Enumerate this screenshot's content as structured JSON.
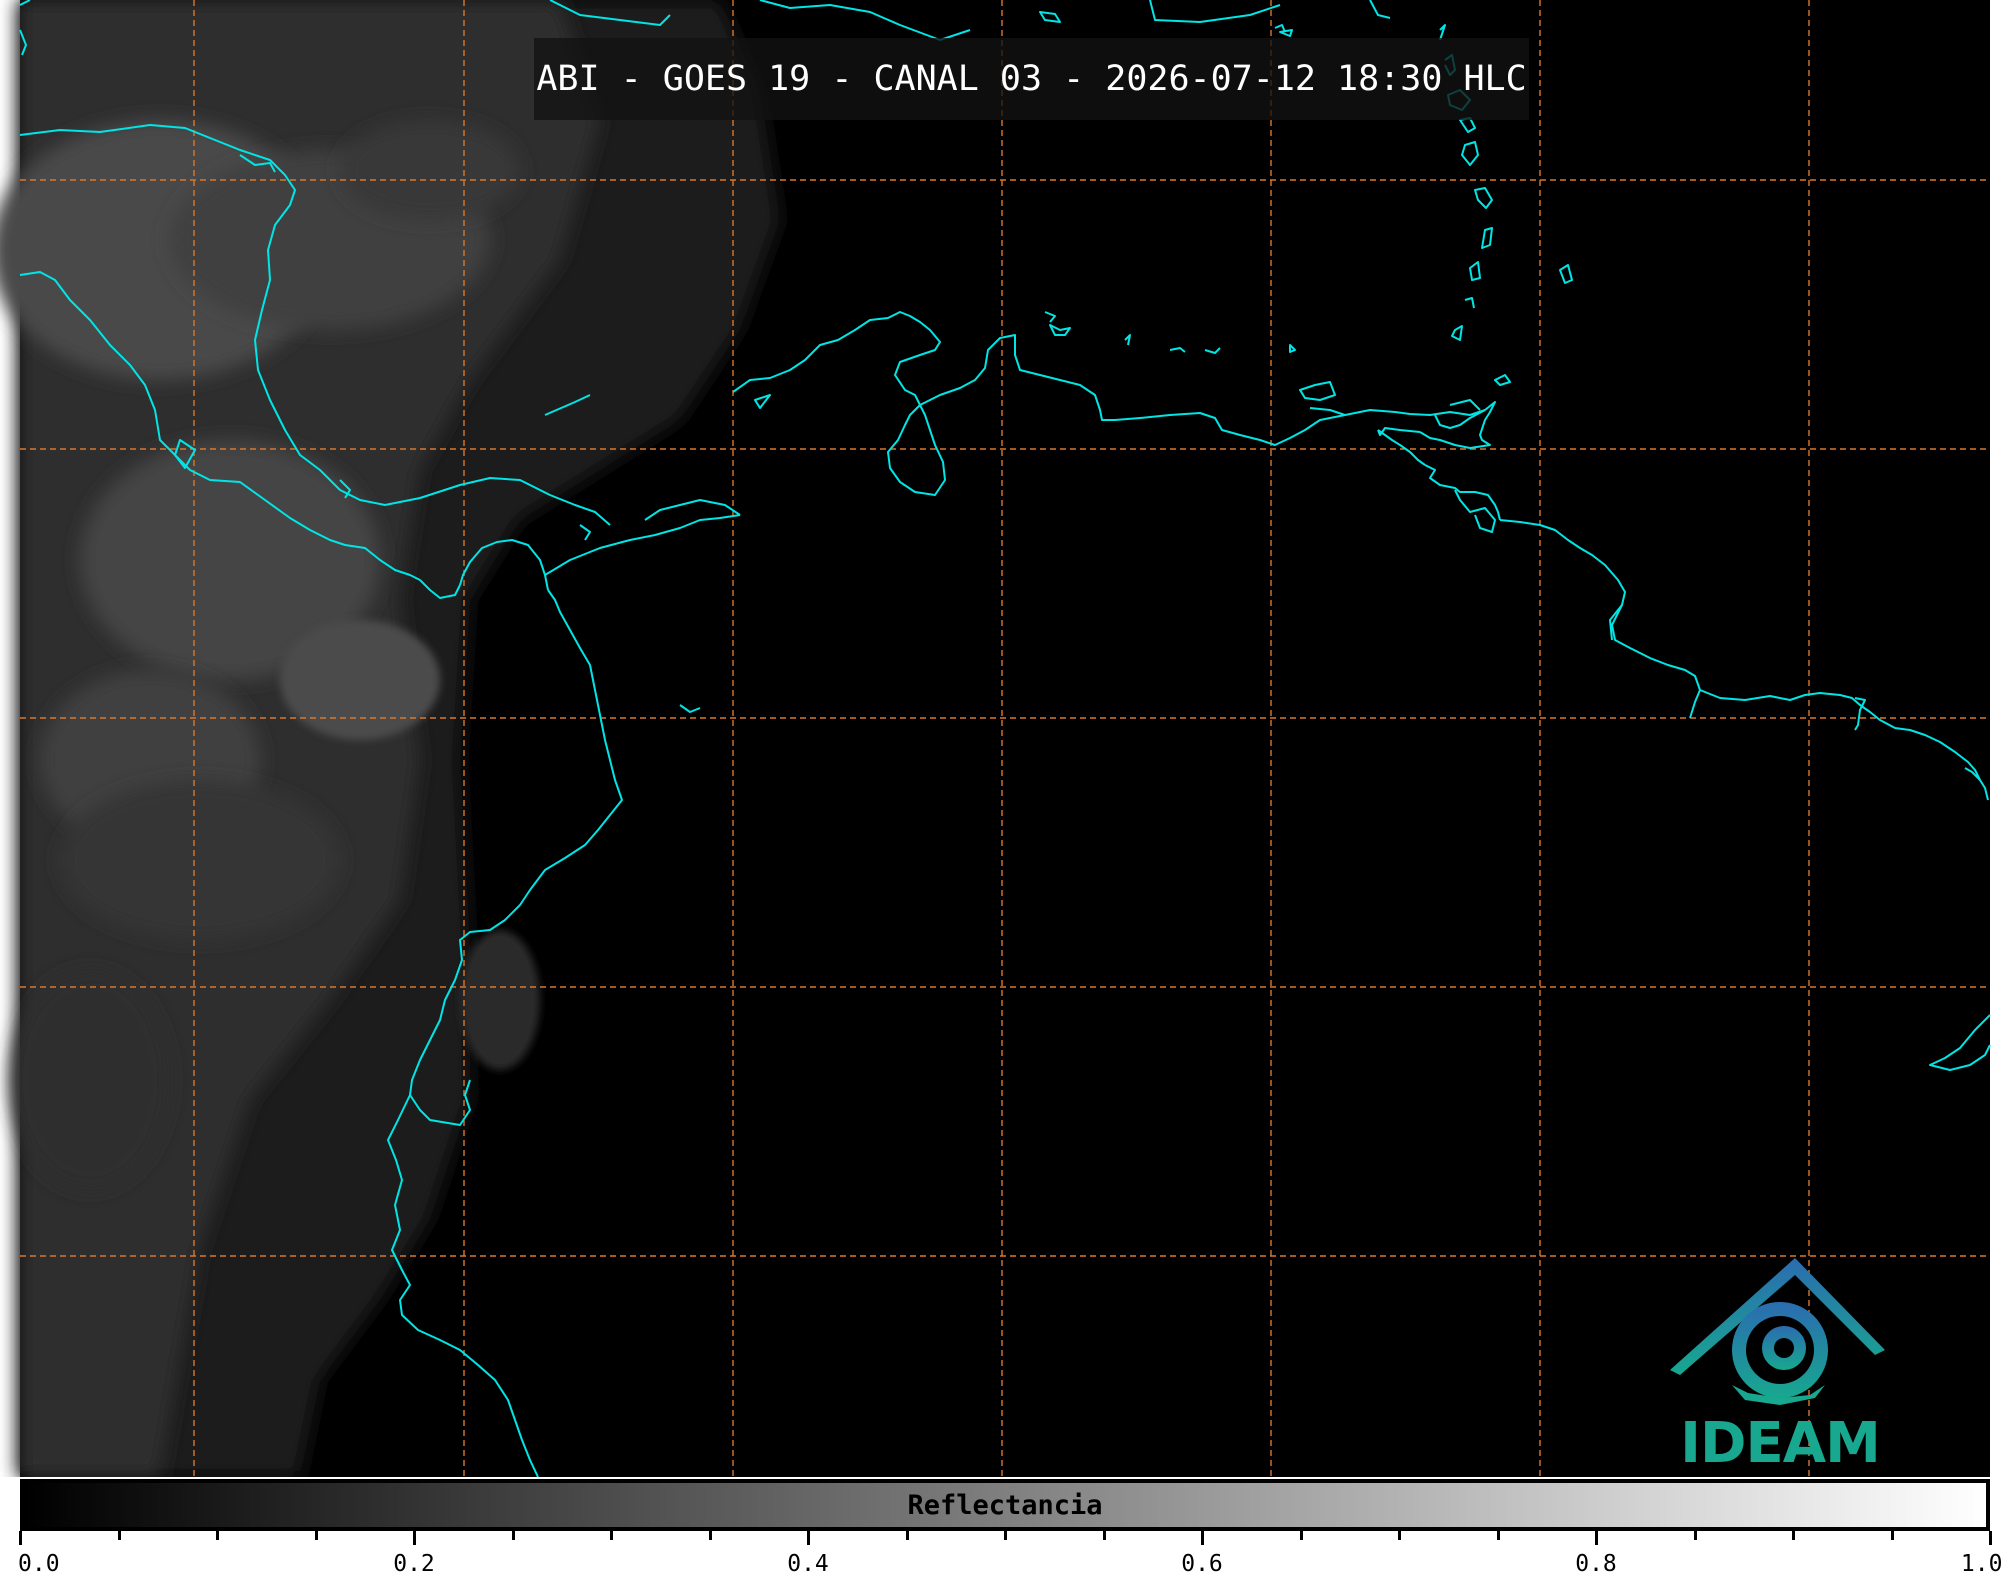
{
  "map": {
    "title": "ABI - GOES 19 - CANAL 03 - 2026-07-12 18:30 HLC",
    "coastline_color": "#00e5e5",
    "grid_color": "#d9772b",
    "background_color": "#000000",
    "cloud_color": "#7a7a7a"
  },
  "logo": {
    "text": "IDEAM",
    "icon": "ideam-logo-icon",
    "colors": [
      "#2b6cb0",
      "#17a88f"
    ]
  },
  "colorbar": {
    "label": "Reflectancia",
    "min": 0.0,
    "max": 1.0,
    "tick_labels": [
      "0.0",
      "0.2",
      "0.4",
      "0.6",
      "0.8",
      "1.0"
    ],
    "colors": [
      "#000000",
      "#ffffff"
    ]
  }
}
